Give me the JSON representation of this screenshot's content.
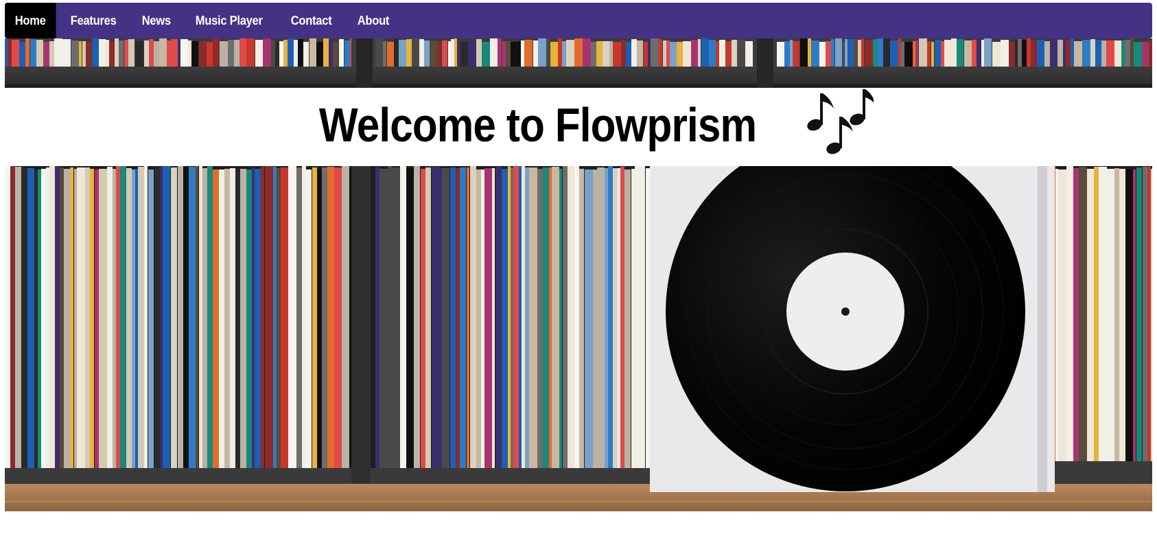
{
  "nav": {
    "items": [
      {
        "label": "Home",
        "active": true
      },
      {
        "label": "Features",
        "active": false
      },
      {
        "label": "News",
        "active": false
      },
      {
        "label": "Music Player",
        "active": false
      },
      {
        "label": "Contact",
        "active": false
      },
      {
        "label": "About",
        "active": false
      }
    ]
  },
  "hero": {
    "title": "Welcome to Flowprism",
    "title_icon": "musical-notes-icon"
  },
  "colors": {
    "nav_background": "#443385",
    "nav_active": "#000000",
    "nav_text": "#ffffff"
  }
}
